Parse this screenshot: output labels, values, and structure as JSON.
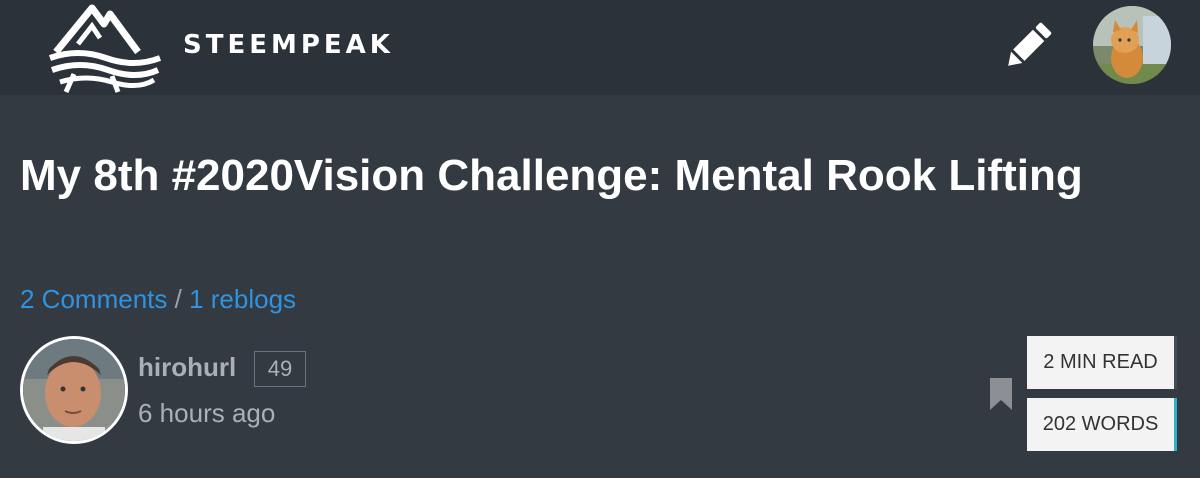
{
  "header": {
    "brand": "STEEMPEAK",
    "icons": {
      "logo": "mountain-wave-logo-icon",
      "compose": "pencil-icon",
      "user": "user-avatar-kitten"
    }
  },
  "post": {
    "title": "My 8th #2020Vision Challenge: Mental Rook Lifting",
    "comments": "2 Comments",
    "separator": "/",
    "reblogs": "1 reblogs",
    "author": {
      "name": "hirohurl",
      "reputation": "49",
      "time": "6 hours ago"
    },
    "read_time": "2 MIN READ",
    "word_count": "202 WORDS"
  },
  "colors": {
    "background": "#343a41",
    "topbar": "#2b3239",
    "link": "#2f93e0",
    "words_accent": "#2ab3c9"
  }
}
